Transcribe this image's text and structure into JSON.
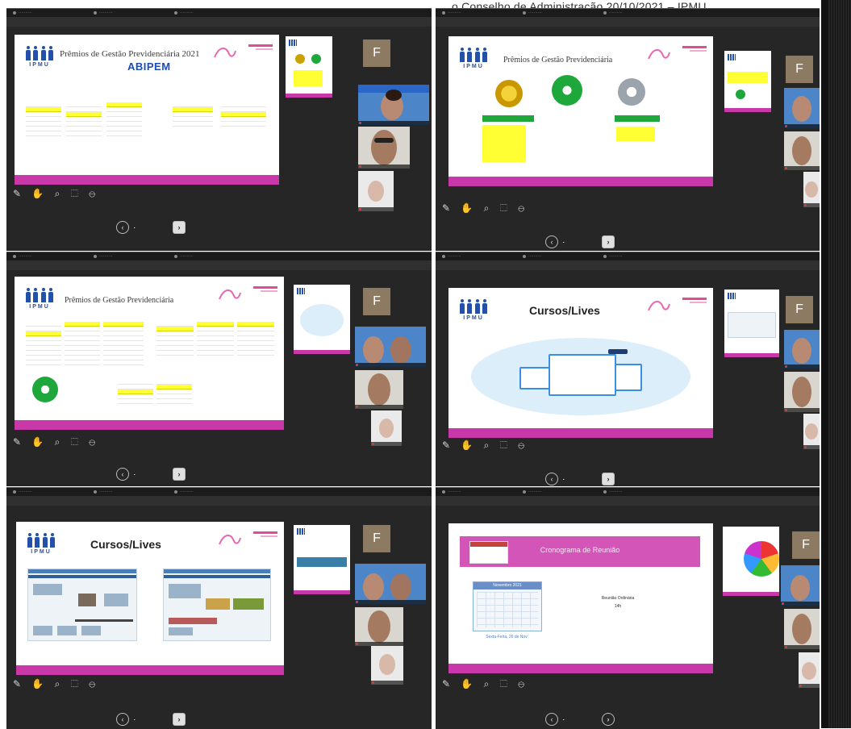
{
  "header": {
    "title": "o Conselho de Administração 20/10/2021 – IPMU"
  },
  "colors": {
    "footer_pink": "#c938a8",
    "ipmu_blue": "#2350a8",
    "panel_bg": "#262626",
    "yellow_highlight": "#ffff33",
    "green_medal": "#1ea73a"
  },
  "panels": [
    {
      "slide_title": "Prêmios de Gestão Previdenciária 2021",
      "slide_logo": "IPMU",
      "brand": "ABIPEM",
      "tile_F": "F"
    },
    {
      "slide_title": "Prêmios de Gestão Previdenciária",
      "slide_logo": "IPMU",
      "tile_F": "F"
    },
    {
      "slide_title": "Prêmios de Gestão Previdenciária",
      "slide_logo": "IPMU",
      "tile_F": "F"
    },
    {
      "slide_title": "Cursos/Lives",
      "slide_logo": "IPMU",
      "tile_F": "F"
    },
    {
      "slide_title": "Cursos/Lives",
      "slide_logo": "IPMU",
      "tile_F": "F"
    },
    {
      "slide_title": "Cronograma de Reunião",
      "tile_F": "F",
      "meeting_type": "Reunião Ordinária",
      "meeting_time": "14h",
      "meeting_date": "Sexta-Feira, 26 de Nov",
      "calendar_header": "Novembro 2021"
    }
  ]
}
